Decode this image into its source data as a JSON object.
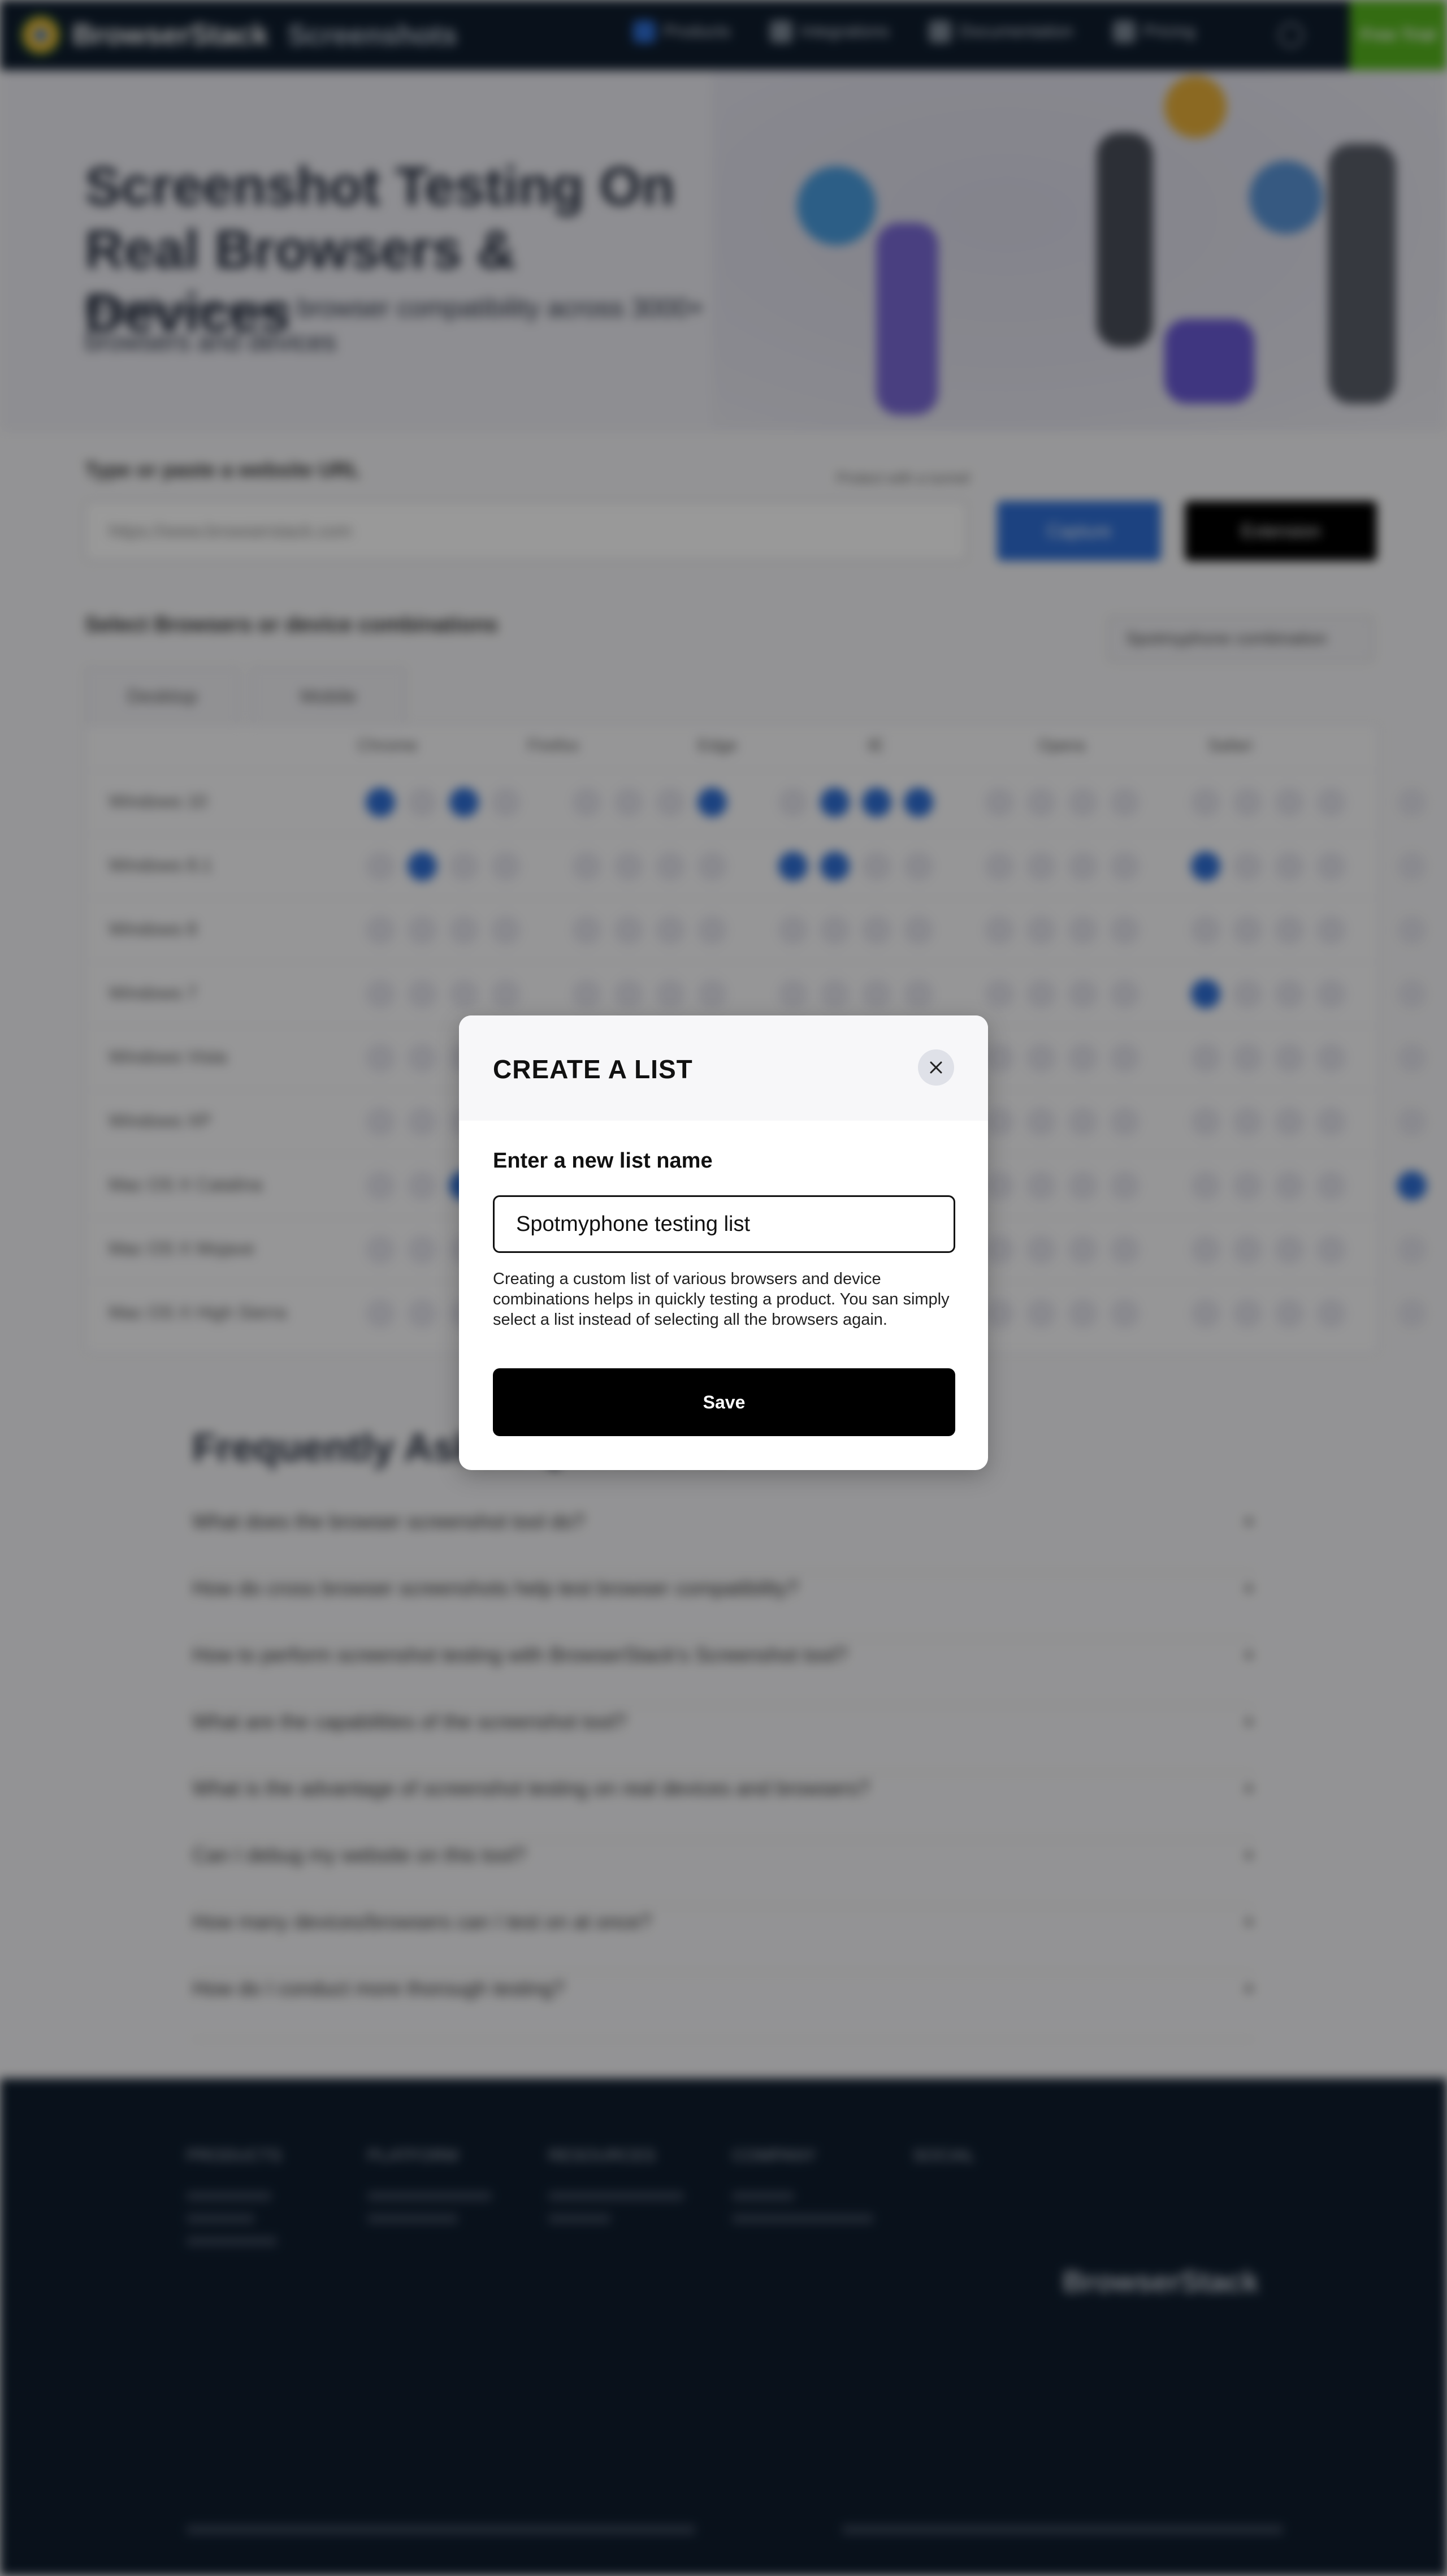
{
  "nav": {
    "brand": "BrowserStack",
    "product": "Screenshots",
    "items": [
      "Products",
      "Integrations",
      "Documentation",
      "Pricing"
    ],
    "cta": "Free Trial"
  },
  "hero": {
    "title": "Screenshot Testing On Real Browsers & Devices",
    "subtitle": "Rapidly test cross browser compatibility across 3000+ browsers and devices"
  },
  "url_section": {
    "label": "Type or paste a website URL",
    "hint": "Protect with a tunnel",
    "placeholder": "https://www.browserstack.com",
    "capture_label": "Capture",
    "extension_label": "Extension"
  },
  "selection": {
    "label": "Select Browsers or device combinations",
    "list_select": "Spotmyphone combination",
    "tabs": [
      "Desktop",
      "Mobile"
    ],
    "browsers": [
      "Chrome",
      "Firefox",
      "Edge",
      "IE",
      "Opera",
      "Safari"
    ],
    "os_rows": [
      "Windows 10",
      "Windows 8.1",
      "Windows 8",
      "Windows 7",
      "Windows Vista",
      "Windows XP",
      "Mac OS X Catalina",
      "Mac OS X Mojave",
      "Mac OS X High Sierra"
    ]
  },
  "faq": {
    "title": "Frequently Asked Questions",
    "questions": [
      "What does the browser screenshot tool do?",
      "How do cross browser screenshots help test browser compatibility?",
      "How to perform screenshot testing with BrowserStack's Screenshot tool?",
      "What are the capabilities of the screenshot tool?",
      "What is the advantage of screenshot testing on real devices and browsers?",
      "Can I debug my website on this tool?",
      "How many devices/browsers can I test on at once?",
      "How do I conduct more thorough testing?"
    ]
  },
  "footer": {
    "columns": [
      "PRODUCTS",
      "PLATFORM",
      "RESOURCES",
      "COMPANY",
      "SOCIAL"
    ],
    "brand": "BrowserStack"
  },
  "modal": {
    "title": "CREATE A LIST",
    "field_label": "Enter a new list name",
    "input_value": "Spotmyphone testing list",
    "help_text": "Creating a custom list of various browsers and device combinations helps in quickly testing a product. You san simply select a list instead of selecting all the browsers again.",
    "save_label": "Save",
    "close_icon": "close-icon"
  }
}
